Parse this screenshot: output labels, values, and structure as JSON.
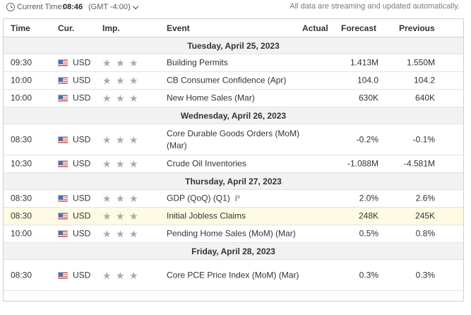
{
  "topbar": {
    "current_time_label": "Current Time:",
    "current_time": "08:46",
    "timezone": "(GMT -4:00)",
    "note": "All data are streaming and updated automatically."
  },
  "table": {
    "headers": {
      "time": "Time",
      "currency": "Cur.",
      "importance": "Imp.",
      "event": "Event",
      "actual": "Actual",
      "forecast": "Forecast",
      "previous": "Previous"
    },
    "groups": [
      {
        "date": "Tuesday, April 25, 2023",
        "events": [
          {
            "time": "09:30",
            "currency": "USD",
            "event": "Building Permits",
            "actual": "",
            "forecast": "1.413M",
            "previous": "1.550M"
          },
          {
            "time": "10:00",
            "currency": "USD",
            "event": "CB Consumer Confidence (Apr)",
            "actual": "",
            "forecast": "104.0",
            "previous": "104.2"
          },
          {
            "time": "10:00",
            "currency": "USD",
            "event": "New Home Sales (Mar)",
            "actual": "",
            "forecast": "630K",
            "previous": "640K"
          }
        ]
      },
      {
        "date": "Wednesday, April 26, 2023",
        "events": [
          {
            "time": "08:30",
            "currency": "USD",
            "event": "Core Durable Goods Orders (MoM) (Mar)",
            "actual": "",
            "forecast": "-0.2%",
            "previous": "-0.1%"
          },
          {
            "time": "10:30",
            "currency": "USD",
            "event": "Crude Oil Inventories",
            "actual": "",
            "forecast": "-1.088M",
            "previous": "-4.581M"
          }
        ]
      },
      {
        "date": "Thursday, April 27, 2023",
        "events": [
          {
            "time": "08:30",
            "currency": "USD",
            "event": "GDP (QoQ) (Q1)",
            "badge": "P",
            "actual": "",
            "forecast": "2.0%",
            "previous": "2.6%"
          },
          {
            "time": "08:30",
            "currency": "USD",
            "event": "Initial Jobless Claims",
            "actual": "",
            "forecast": "248K",
            "previous": "245K",
            "highlight": true
          },
          {
            "time": "10:00",
            "currency": "USD",
            "event": "Pending Home Sales (MoM) (Mar)",
            "actual": "",
            "forecast": "0.5%",
            "previous": "0.8%"
          }
        ]
      },
      {
        "date": "Friday, April 28, 2023",
        "events": [
          {
            "time": "08:30",
            "currency": "USD",
            "event": "Core PCE Price Index (MoM) (Mar)",
            "actual": "",
            "forecast": "0.3%",
            "previous": "0.3%"
          }
        ]
      }
    ]
  },
  "colors": {
    "star": "#a9a9a9",
    "date_row_bg": "#f2f2f2",
    "highlight_row_bg": "#fdfbe3",
    "border": "#cfcfcf"
  },
  "icons": {
    "clock": "clock-icon",
    "dropdown": "chevron-down-icon",
    "flag": "us-flag-icon",
    "importance": "star-icon",
    "preliminary": "preliminary-badge-icon"
  }
}
